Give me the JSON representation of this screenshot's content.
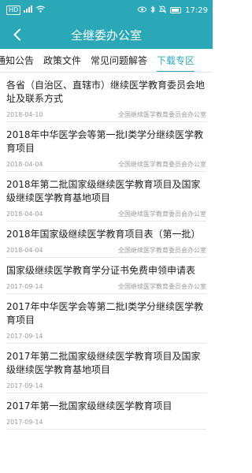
{
  "status": {
    "time": "17:29",
    "signal": "HD"
  },
  "header": {
    "title": "全继委办公室"
  },
  "tabs": [
    {
      "label": "通知公告"
    },
    {
      "label": "政策文件"
    },
    {
      "label": "常见问题解答"
    },
    {
      "label": "下载专区",
      "active": true
    }
  ],
  "items": [
    {
      "title": "各省（自治区、直辖市）继续医学教育委员会地址及联系方式",
      "date": "2018-04-10",
      "source": "全国继续医学教育委员会办公室"
    },
    {
      "title": "2018年中华医学会等第一批Ⅰ类学分继续医学教育项目",
      "date": "2018-04-04",
      "source": "全国继续医学教育委员会办公室"
    },
    {
      "title": "2018年第二批国家级继续医学教育项目及国家级继续医学教育基地项目",
      "date": "2018-04-04",
      "source": "全国继续医学教育委员会办公室"
    },
    {
      "title": "2018年国家级继续医学教育项目表（第一批）",
      "date": "2018-04-04",
      "source": "全国继续医学教育委员会办公室"
    },
    {
      "title": "国家级继续医学教育学分证书免费申领申请表",
      "date": "2017-09-14",
      "source": "全国继续医学教育委员会办公室"
    },
    {
      "title": "2017年中华医学会等第二批Ⅰ类学分继续医学教育项目",
      "date": "2017-09-14",
      "source": ""
    },
    {
      "title": "2017年第二批国家级继续医学教育项目及国家级继续医学教育基地项目",
      "date": "2017-09-14",
      "source": ""
    },
    {
      "title": "2017年第一批国家级继续医学教育项目",
      "date": "2017-09-14",
      "source": ""
    }
  ]
}
